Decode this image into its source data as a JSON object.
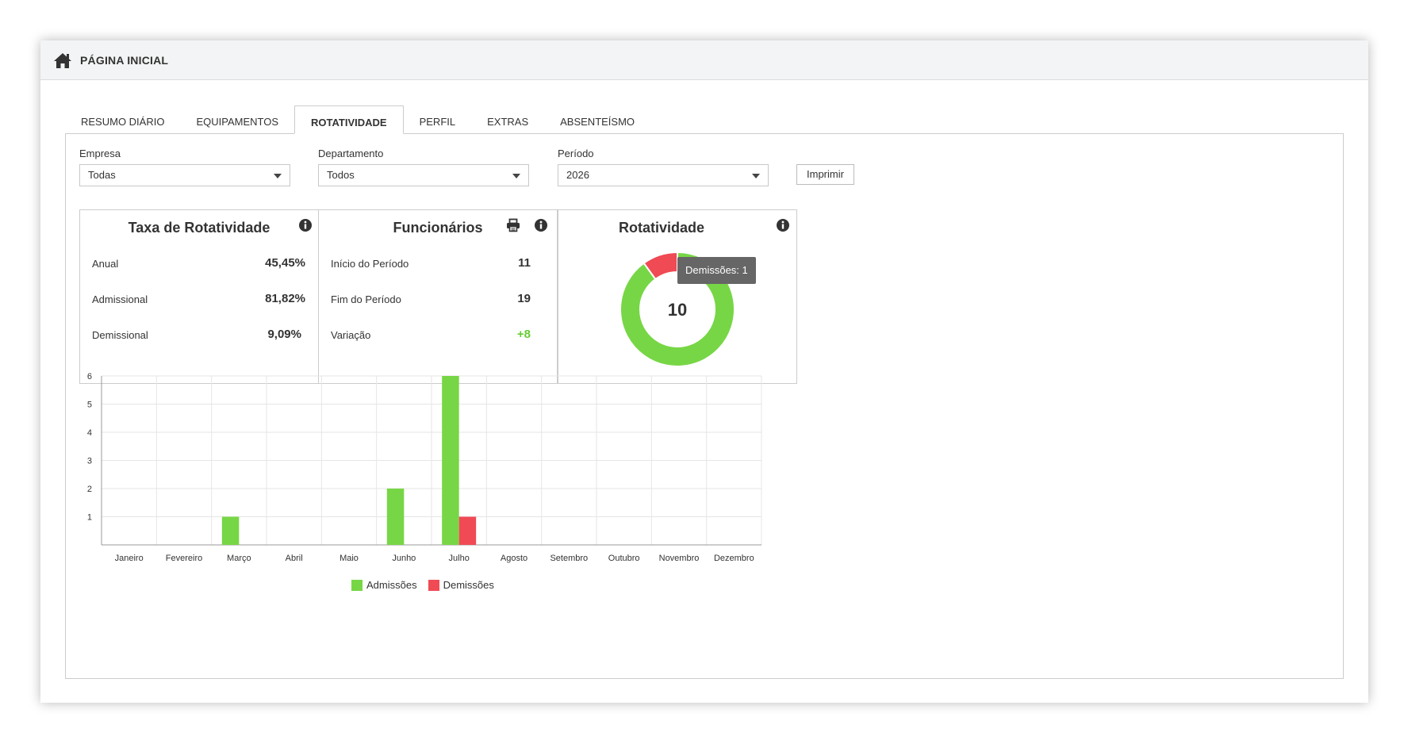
{
  "header": {
    "title": "PÁGINA INICIAL"
  },
  "tabs": [
    {
      "label": "RESUMO DIÁRIO"
    },
    {
      "label": "EQUIPAMENTOS"
    },
    {
      "label": "ROTATIVIDADE"
    },
    {
      "label": "PERFIL"
    },
    {
      "label": "EXTRAS"
    },
    {
      "label": "ABSENTEÍSMO"
    }
  ],
  "filters": {
    "empresa": {
      "label": "Empresa",
      "value": "Todas"
    },
    "departamento": {
      "label": "Departamento",
      "value": "Todos"
    },
    "periodo": {
      "label": "Período",
      "value": "2026"
    },
    "print_label": "Imprimir"
  },
  "taxa": {
    "title": "Taxa de Rotatividade",
    "rows": [
      {
        "label": "Anual",
        "value": "45,45%"
      },
      {
        "label": "Admissional",
        "value": "81,82%"
      },
      {
        "label": "Demissional",
        "value": "9,09%"
      }
    ]
  },
  "funcionarios": {
    "title": "Funcionários",
    "rows": [
      {
        "label": "Início do Período",
        "value": "11"
      },
      {
        "label": "Fim do Período",
        "value": "19"
      },
      {
        "label": "Variação",
        "value": "+8"
      }
    ]
  },
  "rotatividade": {
    "title": "Rotatividade",
    "center_value": "10",
    "tooltip": "Demissões: 1",
    "admissoes": 9,
    "demissoes": 1
  },
  "colors": {
    "admissoes": "#77d645",
    "demissoes": "#f04a55",
    "variation_positive": "#66cc33"
  },
  "chart_data": {
    "type": "bar",
    "categories": [
      "Janeiro",
      "Fevereiro",
      "Março",
      "Abril",
      "Maio",
      "Junho",
      "Julho",
      "Agosto",
      "Setembro",
      "Outubro",
      "Novembro",
      "Dezembro"
    ],
    "series": [
      {
        "name": "Admissões",
        "values": [
          0,
          0,
          1,
          0,
          0,
          2,
          6,
          0,
          0,
          0,
          0,
          0
        ]
      },
      {
        "name": "Demissões",
        "values": [
          0,
          0,
          0,
          0,
          0,
          0,
          1,
          0,
          0,
          0,
          0,
          0
        ]
      }
    ],
    "yticks": [
      1,
      2,
      3,
      4,
      5,
      6
    ],
    "ylim": [
      0,
      6
    ],
    "grid": true,
    "legend": "bottom-center"
  }
}
